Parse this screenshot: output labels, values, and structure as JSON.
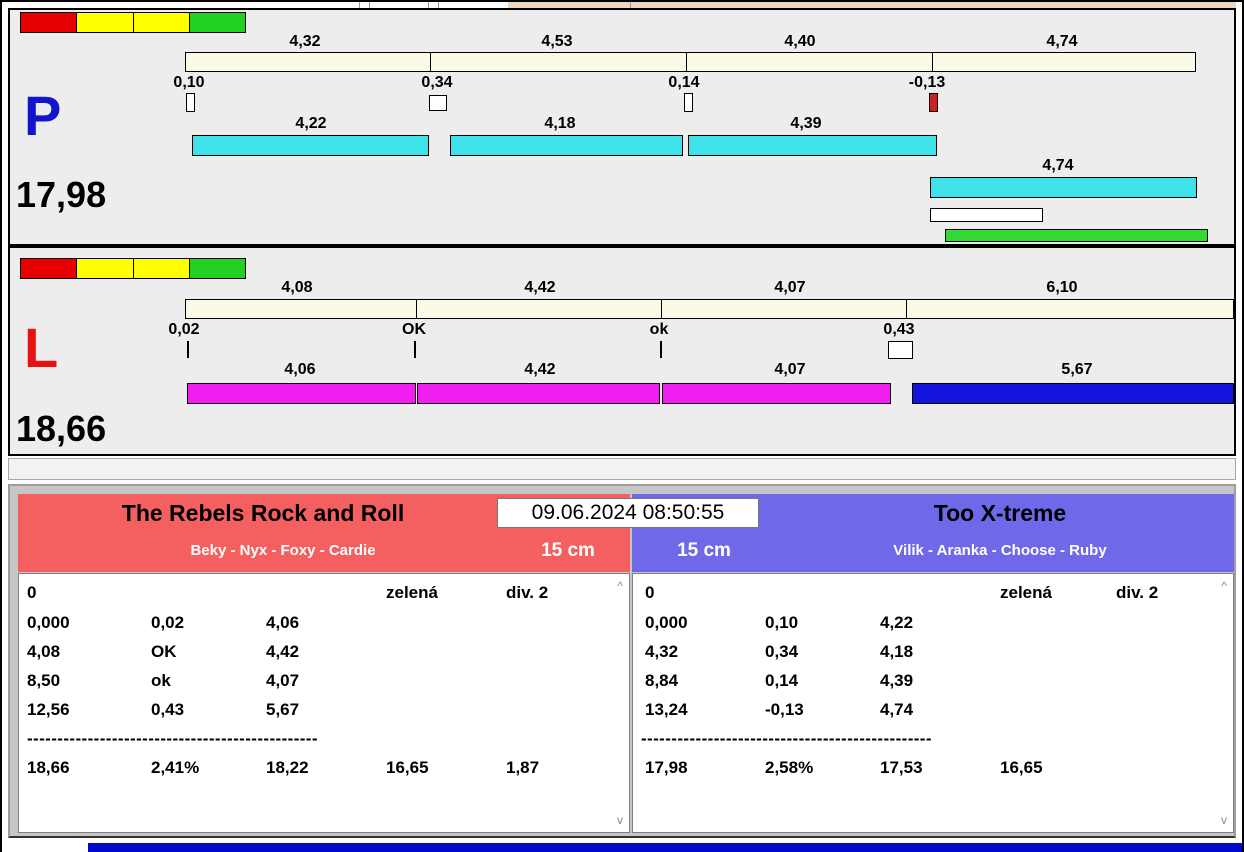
{
  "panels": {
    "p": {
      "letter": "P",
      "total": "17,98",
      "splits": [
        "4,32",
        "4,53",
        "4,40",
        "4,74"
      ],
      "deltas": [
        "0,10",
        "0,34",
        "0,14",
        "-0,13"
      ],
      "run_bars": [
        "4,22",
        "4,18",
        "4,39"
      ],
      "run_bar_last": "4,74",
      "indicator_segments": [
        "red",
        "yellow",
        "yellow",
        "green"
      ]
    },
    "l": {
      "letter": "L",
      "total": "18,66",
      "splits": [
        "4,08",
        "4,42",
        "4,07",
        "6,10"
      ],
      "deltas": [
        "0,02",
        "OK",
        "ok",
        "0,43"
      ],
      "run_bars": [
        "4,06",
        "4,42",
        "4,07"
      ],
      "run_bar_last": "5,67",
      "indicator_segments": [
        "red",
        "yellow",
        "yellow",
        "green"
      ]
    }
  },
  "timestamp": "09.06.2024 08:50:55",
  "teams": {
    "left": {
      "name": "The Rebels Rock and Roll",
      "members": "Beky - Nyx - Foxy - Cardie",
      "height_class": "15 cm",
      "info": {
        "c0": "0",
        "c3": "zelená",
        "c4": "div. 2"
      },
      "rows": [
        {
          "c0": "0,000",
          "c1": "0,02",
          "c2": "4,06"
        },
        {
          "c0": "4,08",
          "c1": "OK",
          "c2": "4,42"
        },
        {
          "c0": "8,50",
          "c1": "ok",
          "c2": "4,07"
        },
        {
          "c0": "12,56",
          "c1": "0,43",
          "c2": "5,67"
        }
      ],
      "separator": "------------------------------------------------",
      "totals": {
        "c0": "18,66",
        "c1": "2,41%",
        "c2": "18,22",
        "c3": "16,65",
        "c4": "1,87"
      }
    },
    "right": {
      "name": "Too X-treme",
      "members": "Vilik - Aranka - Choose - Ruby",
      "height_class": "15 cm",
      "info": {
        "c0": "0",
        "c3": "zelená",
        "c4": "div. 2"
      },
      "rows": [
        {
          "c0": "0,000",
          "c1": "0,10",
          "c2": "4,22"
        },
        {
          "c0": "4,32",
          "c1": "0,34",
          "c2": "4,18"
        },
        {
          "c0": "8,84",
          "c1": "0,14",
          "c2": "4,39"
        },
        {
          "c0": "13,24",
          "c1": "-0,13",
          "c2": "4,74"
        }
      ],
      "separator": "------------------------------------------------",
      "totals": {
        "c0": "17,98",
        "c1": "2,58%",
        "c2": "17,53",
        "c3": "16,65",
        "c4": ""
      }
    }
  },
  "icons": {
    "scroll_up": "^",
    "scroll_down": "v"
  },
  "colors": {
    "cyan_bar": "#3fe2e8",
    "magenta_bar": "#f01ef0",
    "blue_bar": "#1313dc",
    "green_bar": "#35d935",
    "team_left_bg": "#f4605f",
    "team_right_bg": "#6f68e8",
    "letter_p": "#1414cc",
    "letter_l": "#e41414"
  }
}
